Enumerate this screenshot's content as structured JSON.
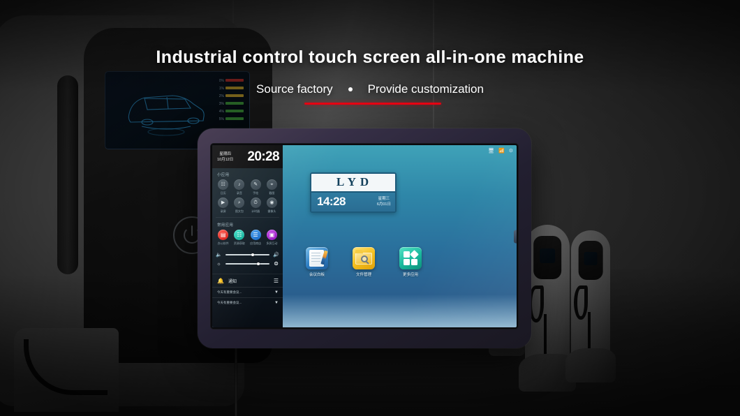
{
  "banner": {
    "headline": "Industrial control touch screen all-in-one machine",
    "sub_left": "Source factory",
    "sub_right": "Provide customization",
    "separator": "•",
    "accent_color": "#e60012"
  },
  "background": {
    "scene": "ev-charging-station-showroom",
    "charger_display_bars": [
      "0%",
      "1%",
      "2%",
      "3%",
      "4%",
      "5%"
    ]
  },
  "tablet": {
    "panel": {
      "clock": {
        "weekday": "星期四",
        "date": "10月12日",
        "time": "20:28"
      },
      "small_apps_title": "小应用",
      "small_apps": [
        {
          "label": "日历",
          "icon": "calendar-icon",
          "glyph": "☷"
        },
        {
          "label": "录音",
          "icon": "record-icon",
          "glyph": "♪"
        },
        {
          "label": "手绘",
          "icon": "draw-icon",
          "glyph": "✎"
        },
        {
          "label": "截图",
          "icon": "screenshot-icon",
          "glyph": "⌖"
        },
        {
          "label": "录屏",
          "icon": "screen-record-icon",
          "glyph": "▶"
        },
        {
          "label": "图文包",
          "icon": "search-icon",
          "glyph": "⌕"
        },
        {
          "label": "计时器",
          "icon": "timer-icon",
          "glyph": "⏱"
        },
        {
          "label": "摄像头",
          "icon": "camera-icon",
          "glyph": "◉"
        }
      ],
      "common_apps_title": "常用应用",
      "common_apps": [
        {
          "label": "办公软件",
          "icon": "office-icon",
          "glyph": "▤",
          "color": "#e0201b"
        },
        {
          "label": "资源获取",
          "icon": "globe-icon",
          "glyph": "☷",
          "color": "#11b9a6"
        },
        {
          "label": "应用商店",
          "icon": "store-icon",
          "glyph": "☰",
          "color": "#1878d6"
        },
        {
          "label": "多屏互动",
          "icon": "share-screen-icon",
          "glyph": "▣",
          "color": "#a420c9"
        }
      ],
      "sliders": [
        {
          "name": "volume",
          "icon_low": "volume-low-icon",
          "icon_high": "volume-high-icon",
          "value": 62
        },
        {
          "name": "brightness",
          "icon_low": "brightness-low-icon",
          "icon_high": "brightness-high-icon",
          "value": 75
        }
      ],
      "notifications": {
        "title": "通知",
        "bell_icon": "bell-icon",
        "menu_icon": "hamburger-icon",
        "items": [
          "今天有重要会议...",
          "今天有重要会议..."
        ]
      }
    },
    "desktop": {
      "statusbar": [
        {
          "name": "display-icon",
          "glyph": "▭"
        },
        {
          "name": "wifi-icon",
          "glyph": "▲"
        },
        {
          "name": "settings-icon",
          "glyph": "◈"
        }
      ],
      "widget": {
        "brand": "LYD",
        "time": "14:28",
        "weekday": "星期三",
        "date": "6月01日"
      },
      "apps": [
        {
          "label": "会议白板",
          "icon": "whiteboard-icon"
        },
        {
          "label": "文件管理",
          "icon": "file-manager-icon"
        },
        {
          "label": "更多应用",
          "icon": "more-apps-icon"
        }
      ],
      "side_tab": {
        "name": "side-handle",
        "glyph": "⋮"
      }
    }
  }
}
